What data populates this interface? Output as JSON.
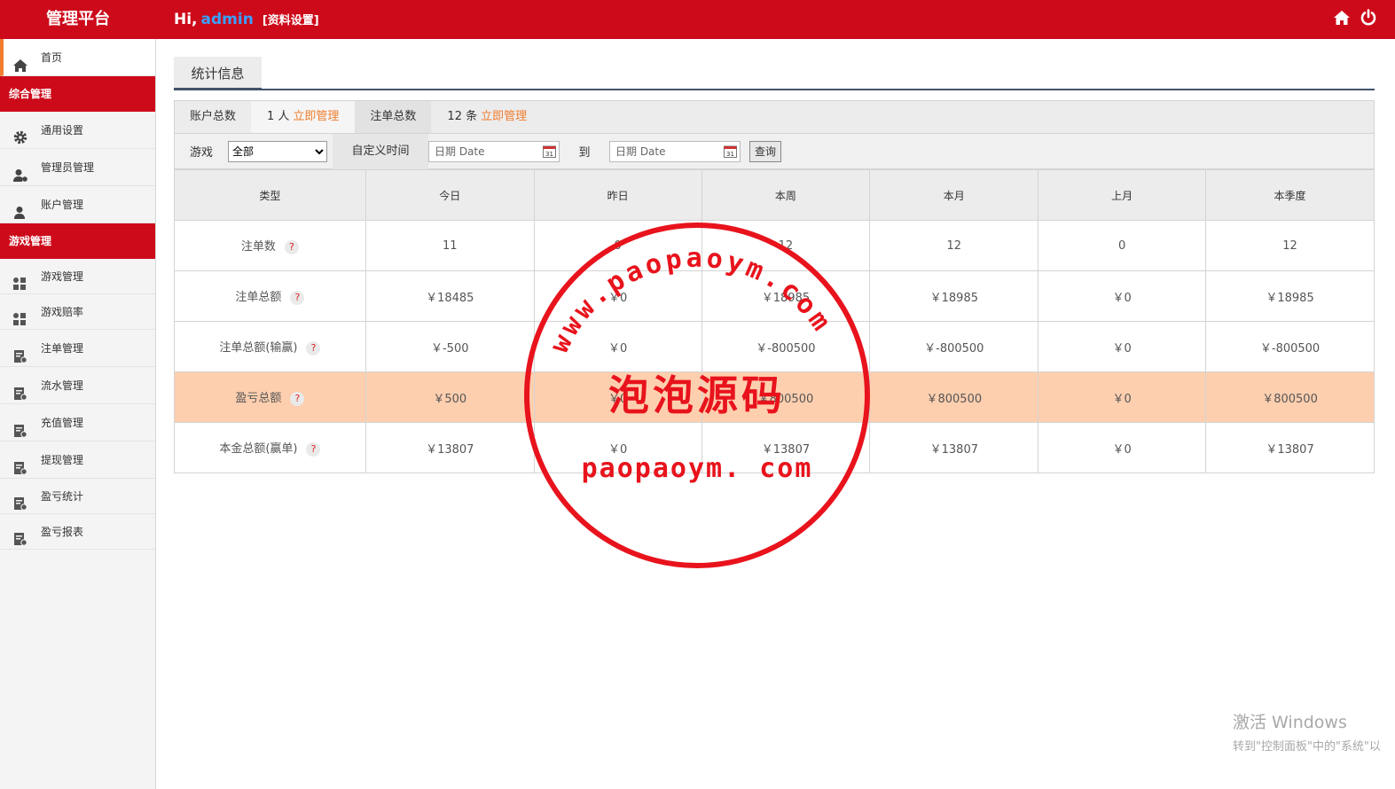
{
  "header": {
    "brand": "管理平台",
    "greeting": "Hi,",
    "username": "admin",
    "profile_link": "[资料设置]"
  },
  "sidebar": {
    "home": "首页",
    "group1": "综合管理",
    "group1_items": [
      "通用设置",
      "管理员管理",
      "账户管理"
    ],
    "group2": "游戏管理",
    "group2_items": [
      "游戏管理",
      "游戏赔率",
      "注单管理",
      "流水管理",
      "充值管理",
      "提现管理",
      "盈亏统计",
      "盈亏报表"
    ]
  },
  "main": {
    "tab": "统计信息",
    "summary": {
      "accounts_label": "账户总数",
      "accounts_value": "1 人",
      "accounts_link": "立即管理",
      "orders_label": "注单总数",
      "orders_value": "12 条",
      "orders_link": "立即管理"
    },
    "filter": {
      "game_label": "游戏",
      "game_selected": "全部",
      "custom_time_label": "自定义时间",
      "date_placeholder": "日期 Date",
      "to_label": "到",
      "query_button": "查询"
    },
    "table": {
      "headers": [
        "类型",
        "今日",
        "昨日",
        "本周",
        "本月",
        "上月",
        "本季度"
      ],
      "rows": [
        {
          "label": "注单数",
          "values": [
            "11",
            "0",
            "12",
            "12",
            "0",
            "12"
          ]
        },
        {
          "label": "注单总额",
          "values": [
            "￥18485",
            "￥0",
            "￥18985",
            "￥18985",
            "￥0",
            "￥18985"
          ]
        },
        {
          "label": "注单总额(输赢)",
          "values": [
            "￥-500",
            "￥0",
            "￥-800500",
            "￥-800500",
            "￥0",
            "￥-800500"
          ]
        },
        {
          "label": "盈亏总额",
          "values": [
            "￥500",
            "￥0",
            "￥800500",
            "￥800500",
            "￥0",
            "￥800500"
          ]
        },
        {
          "label": "本金总额(赢单)",
          "values": [
            "￥13807",
            "￥0",
            "￥13807",
            "￥13807",
            "￥0",
            "￥13807"
          ]
        }
      ],
      "help_glyph": "?"
    }
  },
  "stamp": {
    "arc_text": "www.paopaoym.com",
    "center_text": "泡泡源码",
    "bottom_text": "paopaoym. com",
    "color": "#e8131c"
  },
  "watermark": {
    "line1": "激活 Windows",
    "line2": "转到\"控制面板\"中的\"系统\"以"
  },
  "colors": {
    "header_red": "#cd0a1a",
    "accent_orange": "#f07d2e",
    "highlight_row": "#fecfaf",
    "username_blue": "#39a0ff"
  }
}
